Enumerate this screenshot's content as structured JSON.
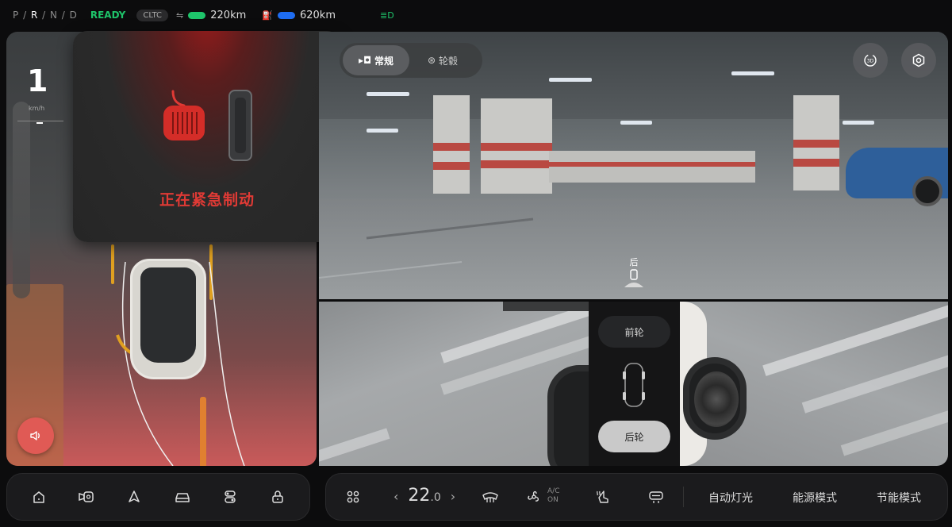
{
  "status": {
    "gear_prefix": "P",
    "gear_active": "R",
    "gear_rest": "N / D",
    "ready": "READY",
    "cycle": "CLTC",
    "range_ev": "220km",
    "range_fuel": "620km",
    "ev_color": "#1ec46a",
    "fuel_color": "#1e6cf0"
  },
  "speed": {
    "value": "1",
    "unit": "km/h"
  },
  "alert": {
    "text": "正在紧急制动",
    "color": "#e03a35"
  },
  "camera": {
    "tabs": [
      {
        "label": "常规",
        "icon": "camera-icon",
        "active": true
      },
      {
        "label": "轮毂",
        "icon": "wheel-icon",
        "active": false
      }
    ],
    "rear_label": "后"
  },
  "wheel_selector": {
    "front": "前轮",
    "rear": "后轮",
    "selected": "后轮"
  },
  "dock": {
    "temperature": "22",
    "temperature_decimal": ".0",
    "ac_label": "A/C",
    "ac_state": "ON",
    "auto_light": "自动灯光",
    "energy_mode": "能源模式",
    "eco_mode": "节能模式"
  }
}
